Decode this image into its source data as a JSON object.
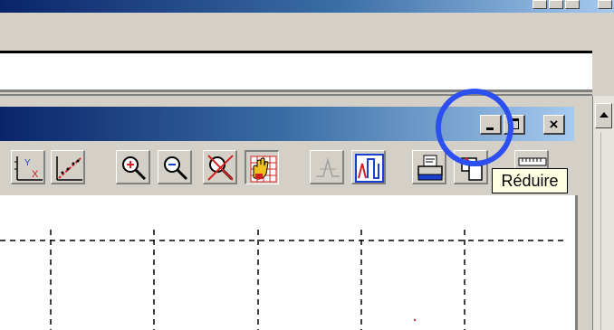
{
  "outer_window": {
    "caption_buttons": [
      "minimize-icon",
      "maximize-icon",
      "close-icon"
    ]
  },
  "child_window": {
    "caption_buttons": {
      "minimize": "minimize-icon",
      "maximize": "maximize-icon",
      "close": "close-icon"
    }
  },
  "toolbar": {
    "buttons": [
      {
        "name": "axis-xy-icon",
        "pressed": false
      },
      {
        "name": "trend-line-icon",
        "pressed": false
      },
      {
        "name": "zoom-in-icon",
        "pressed": false
      },
      {
        "name": "zoom-out-icon",
        "pressed": false
      },
      {
        "name": "zoom-cancel-icon",
        "pressed": false
      },
      {
        "name": "pan-hand-grid-icon",
        "pressed": true
      },
      {
        "name": "peak-icon",
        "pressed": false,
        "disabled": true
      },
      {
        "name": "step-signal-icon",
        "pressed": false
      },
      {
        "name": "print-icon",
        "pressed": false
      },
      {
        "name": "copy-icon",
        "pressed": false
      },
      {
        "name": "ruler-icon",
        "pressed": false
      }
    ]
  },
  "tooltip": {
    "text": "Réduire"
  },
  "colors": {
    "titlebar_start": "#0a246a",
    "titlebar_end": "#a6caf0",
    "highlight_ring": "#2b4ff0",
    "tooltip_bg": "#ffffe1",
    "toolbar_accent_red": "#e03030"
  }
}
